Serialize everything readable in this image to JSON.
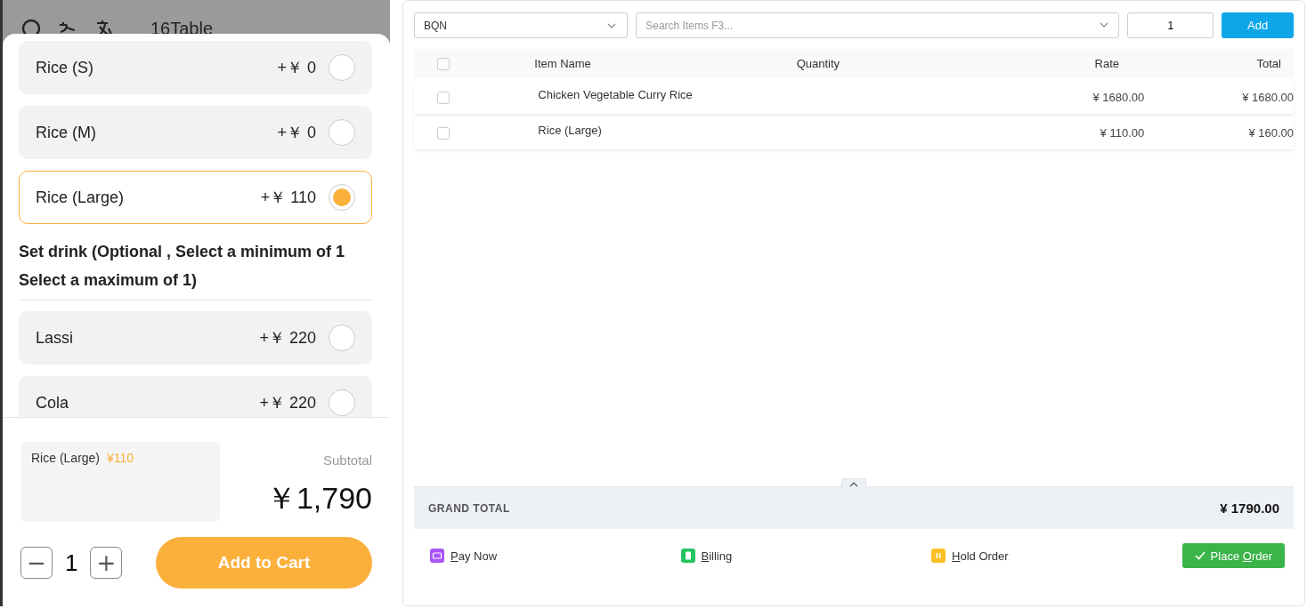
{
  "phone": {
    "header_title": "16Table",
    "options": [
      {
        "name": "Rice (S)",
        "price": "+￥ 0",
        "selected": false
      },
      {
        "name": "Rice (M)",
        "price": "+￥ 0",
        "selected": false
      },
      {
        "name": "Rice (Large)",
        "price": "+￥ 110",
        "selected": true
      }
    ],
    "section_title": "Set drink (Optional , Select a minimum of 1 Select a maximum of 1)",
    "drinks": [
      {
        "name": "Lassi",
        "price": "+￥ 220",
        "selected": false
      },
      {
        "name": "Cola",
        "price": "+￥ 220",
        "selected": false
      }
    ],
    "summary": {
      "item": "Rice (Large)",
      "price": "¥110"
    },
    "subtotal_label": "Subtotal",
    "subtotal": "￥1,790",
    "minus": "−",
    "quantity": "1",
    "plus": "+",
    "add_to_cart": "Add to Cart"
  },
  "pos": {
    "customer": "BQN",
    "search": {
      "placeholder": "Search Items F3..."
    },
    "qty": "1",
    "add": "Add",
    "select_all_checked": false,
    "columns": [
      "Item Name",
      "Quantity",
      "Rate",
      "Total"
    ],
    "rows": [
      {
        "checked": false,
        "name": "Chicken Vegetable Curry Rice",
        "rate": "¥ 1680.00",
        "total": "¥ 1680.00"
      },
      {
        "checked": false,
        "name": "Rice (Large)",
        "rate": "¥ 110.00",
        "total": "¥ 160.00"
      }
    ],
    "grand_total_label": "GRAND TOTAL",
    "grand_total": "¥ 1790.00",
    "actions": [
      {
        "kind": "pay",
        "key": "P",
        "after": "ay Now"
      },
      {
        "kind": "billing",
        "key": "B",
        "after": "illing"
      },
      {
        "kind": "hold",
        "key": "H",
        "after": "old Order"
      }
    ],
    "place_order": {
      "before": "Place ",
      "key": "O",
      "after": "rder"
    }
  }
}
